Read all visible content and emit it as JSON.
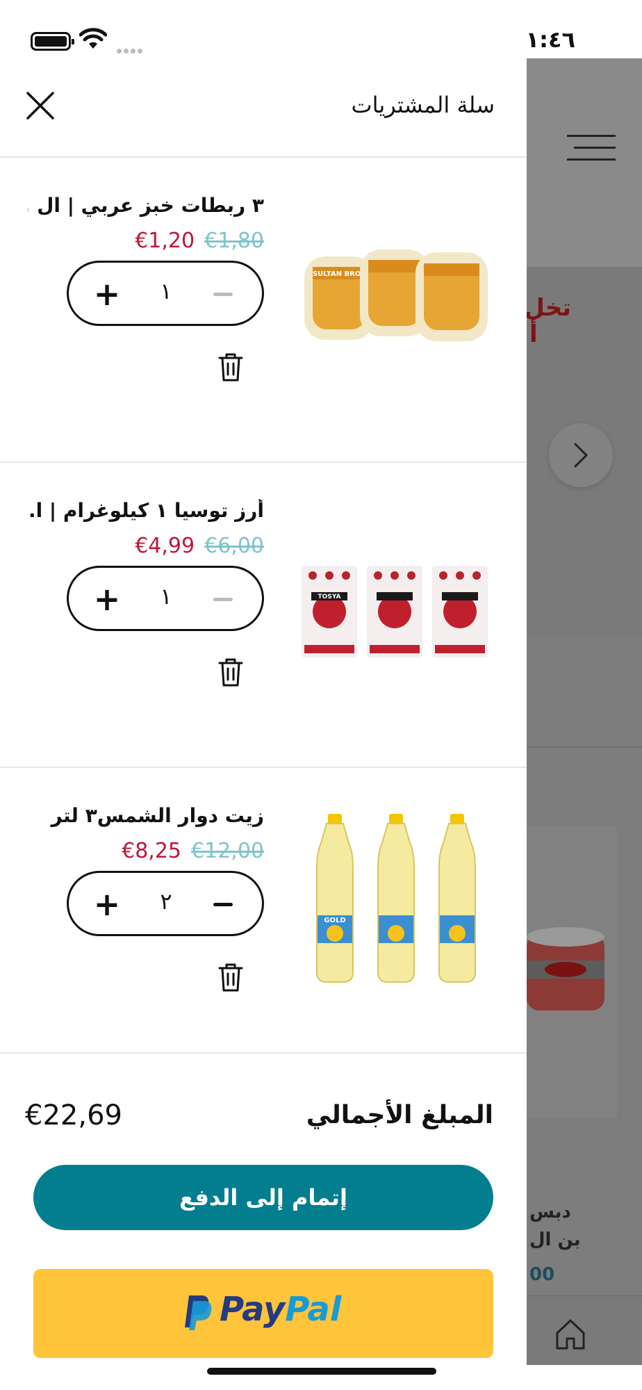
{
  "status_bar": {
    "time": "١:٤٦"
  },
  "background_app": {
    "banner_text": "تخل أ",
    "product_title": "دبس بن ال",
    "product_price": "00"
  },
  "cart": {
    "title": "سلة المشتريات",
    "items": [
      {
        "title": "٣ ربطات خبز عربي | ال ...",
        "price": "€1,20",
        "old_price": "€1,80",
        "quantity": "١",
        "image_text": "SULTAN BROT"
      },
      {
        "title": "أرز توسيا ١ كيلوغرام | ا...",
        "price": "€4,99",
        "old_price": "€6,00",
        "quantity": "١",
        "image_text": "TOSYA"
      },
      {
        "title": "زيت دوار الشمس٣ لتر",
        "price": "€8,25",
        "old_price": "€12,00",
        "quantity": "٢",
        "image_text": "GOLD"
      }
    ],
    "total_label": "المبلغ الأجمالي",
    "total_value": "€22,69",
    "checkout_label": "إتمام إلى الدفع",
    "paypal": {
      "pay": "Pay",
      "pal": "Pal"
    }
  },
  "colors": {
    "accent": "#027e8f",
    "price_new": "#c01638",
    "price_old": "#7ec4cd",
    "paypal_bg": "#ffc43a"
  }
}
